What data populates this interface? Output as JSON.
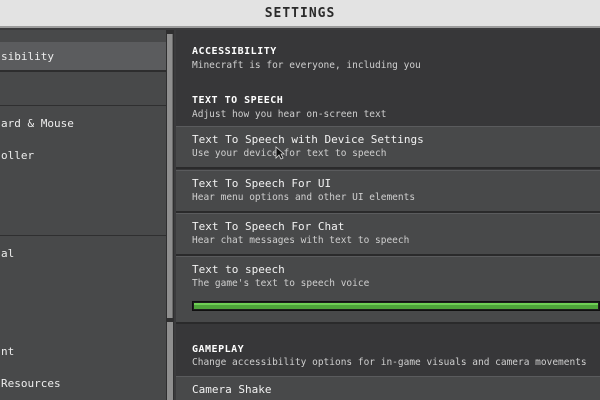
{
  "window": {
    "title": "SETTINGS"
  },
  "sidebar": {
    "items": [
      {
        "label": "sibility",
        "selected": true
      },
      {
        "label": ""
      },
      {
        "label": "ard & Mouse"
      },
      {
        "label": "oller"
      },
      {
        "label": ""
      },
      {
        "label": ""
      },
      {
        "label": "al"
      },
      {
        "label": ""
      },
      {
        "label": ""
      },
      {
        "label": "nt"
      },
      {
        "label": " Resources"
      }
    ]
  },
  "content": {
    "accessibility": {
      "heading": "ACCESSIBILITY",
      "subtitle": "Minecraft is for everyone, including you"
    },
    "tts_section": {
      "heading": "TEXT TO SPEECH",
      "subtitle": "Adjust how you hear on-screen text"
    },
    "options": [
      {
        "title": "Text To Speech with Device Settings",
        "desc": "Use your device for text to speech"
      },
      {
        "title": "Text To Speech For UI",
        "desc": "Hear menu options and other UI elements"
      },
      {
        "title": "Text To Speech For Chat",
        "desc": "Hear chat messages with text to speech"
      }
    ],
    "voice_slider": {
      "title": "Text to speech",
      "desc": "The game's text to speech voice",
      "value": 1.0
    },
    "gameplay": {
      "heading": "GAMEPLAY",
      "subtitle": "Change accessibility options for in-game visuals and camera movements"
    },
    "camera_shake": {
      "title": "Camera Shake"
    }
  },
  "colors": {
    "slider_fill": "#4ea43a",
    "panel": "#48494a",
    "background": "#373739"
  }
}
